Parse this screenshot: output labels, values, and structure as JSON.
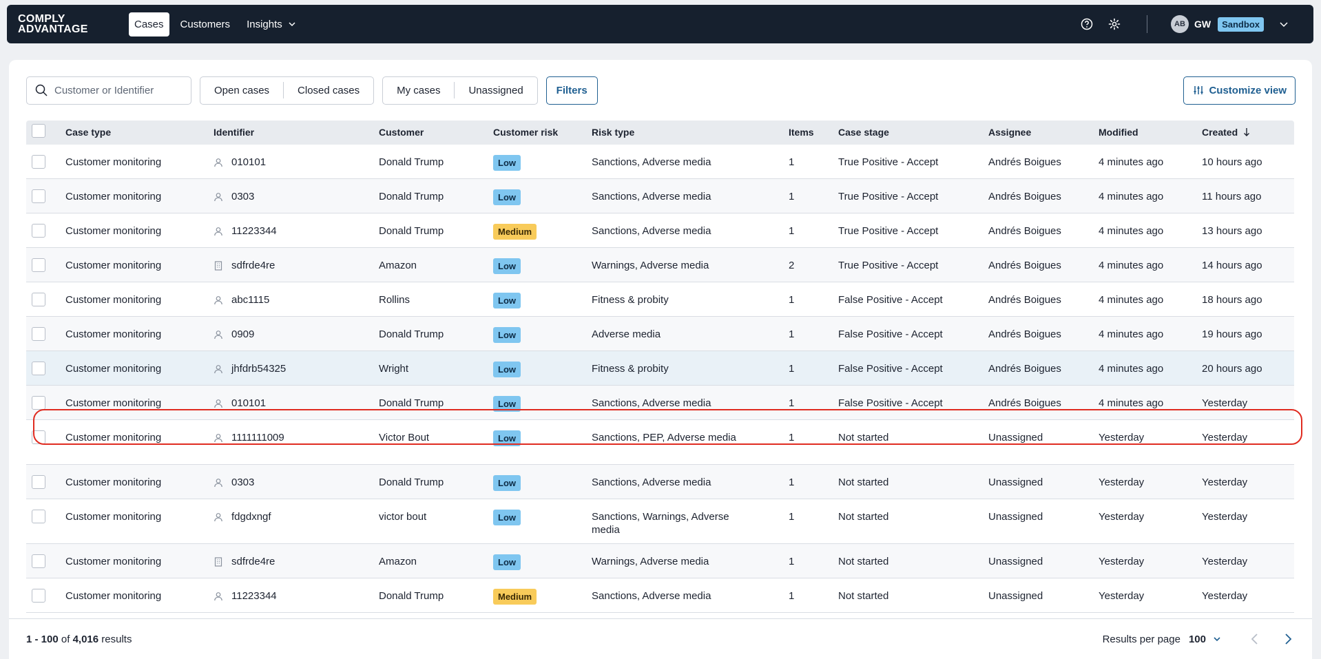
{
  "brand": {
    "line1": "COMPLY",
    "line2": "ADVANTAGE"
  },
  "nav": {
    "cases": "Cases",
    "customers": "Customers",
    "insights": "Insights"
  },
  "user": {
    "avatar_initials": "AB",
    "org_initials": "GW",
    "environment": "Sandbox"
  },
  "toolbar": {
    "search_placeholder": "Customer or Identifier",
    "open_cases": "Open cases",
    "closed_cases": "Closed cases",
    "my_cases": "My cases",
    "unassigned": "Unassigned",
    "filters": "Filters",
    "customize_view": "Customize view"
  },
  "columns": {
    "case_type": "Case type",
    "identifier": "Identifier",
    "customer": "Customer",
    "customer_risk": "Customer risk",
    "risk_type": "Risk type",
    "items": "Items",
    "case_stage": "Case stage",
    "assignee": "Assignee",
    "modified": "Modified",
    "created": "Created"
  },
  "rows": [
    {
      "case_type": "Customer monitoring",
      "id_icon": "person-icon",
      "identifier": "010101",
      "customer": "Donald Trump",
      "risk": "Low",
      "risk_type": "Sanctions, Adverse media",
      "items": "1",
      "stage": "True Positive - Accept",
      "assignee": "Andrés Boigues",
      "modified": "4 minutes ago",
      "created": "10 hours ago"
    },
    {
      "case_type": "Customer monitoring",
      "id_icon": "person-icon",
      "identifier": "0303",
      "customer": "Donald Trump",
      "risk": "Low",
      "risk_type": "Sanctions, Adverse media",
      "items": "1",
      "stage": "True Positive - Accept",
      "assignee": "Andrés Boigues",
      "modified": "4 minutes ago",
      "created": "11 hours ago"
    },
    {
      "case_type": "Customer monitoring",
      "id_icon": "person-icon",
      "identifier": "11223344",
      "customer": "Donald Trump",
      "risk": "Medium",
      "risk_type": "Sanctions, Adverse media",
      "items": "1",
      "stage": "True Positive - Accept",
      "assignee": "Andrés Boigues",
      "modified": "4 minutes ago",
      "created": "13 hours ago"
    },
    {
      "case_type": "Customer monitoring",
      "id_icon": "building-icon",
      "identifier": "sdfrde4re",
      "customer": "Amazon",
      "risk": "Low",
      "risk_type": "Warnings, Adverse media",
      "items": "2",
      "stage": "True Positive - Accept",
      "assignee": "Andrés Boigues",
      "modified": "4 minutes ago",
      "created": "14 hours ago"
    },
    {
      "case_type": "Customer monitoring",
      "id_icon": "person-icon",
      "identifier": "abc1115",
      "customer": "Rollins",
      "risk": "Low",
      "risk_type": "Fitness & probity",
      "items": "1",
      "stage": "False Positive - Accept",
      "assignee": "Andrés Boigues",
      "modified": "4 minutes ago",
      "created": "18 hours ago"
    },
    {
      "case_type": "Customer monitoring",
      "id_icon": "person-icon",
      "identifier": "0909",
      "customer": "Donald Trump",
      "risk": "Low",
      "risk_type": "Adverse media",
      "items": "1",
      "stage": "False Positive - Accept",
      "assignee": "Andrés Boigues",
      "modified": "4 minutes ago",
      "created": "19 hours ago"
    },
    {
      "case_type": "Customer monitoring",
      "id_icon": "person-icon",
      "identifier": "jhfdrb54325",
      "customer": "Wright",
      "risk": "Low",
      "risk_type": "Fitness & probity",
      "items": "1",
      "stage": "False Positive - Accept",
      "assignee": "Andrés Boigues",
      "modified": "4 minutes ago",
      "created": "20 hours ago"
    },
    {
      "case_type": "Customer monitoring",
      "id_icon": "person-icon",
      "identifier": "010101",
      "customer": "Donald Trump",
      "risk": "Low",
      "risk_type": "Sanctions, Adverse media",
      "items": "1",
      "stage": "False Positive - Accept",
      "assignee": "Andrés Boigues",
      "modified": "4 minutes ago",
      "created": "Yesterday"
    },
    {
      "case_type": "Customer monitoring",
      "id_icon": "person-icon",
      "identifier": "1111111009",
      "customer": "Victor Bout",
      "risk": "Low",
      "risk_type": "Sanctions, PEP, Adverse media",
      "items": "1",
      "stage": "Not started",
      "assignee": "Unassigned",
      "modified": "Yesterday",
      "created": "Yesterday"
    },
    {
      "case_type": "Customer monitoring",
      "id_icon": "person-icon",
      "identifier": "0303",
      "customer": "Donald Trump",
      "risk": "Low",
      "risk_type": "Sanctions, Adverse media",
      "items": "1",
      "stage": "Not started",
      "assignee": "Unassigned",
      "modified": "Yesterday",
      "created": "Yesterday"
    },
    {
      "case_type": "Customer monitoring",
      "id_icon": "person-icon",
      "identifier": "fdgdxngf",
      "customer": "victor bout",
      "risk": "Low",
      "risk_type": "Sanctions, Warnings, Adverse media",
      "items": "1",
      "stage": "Not started",
      "assignee": "Unassigned",
      "modified": "Yesterday",
      "created": "Yesterday"
    },
    {
      "case_type": "Customer monitoring",
      "id_icon": "building-icon",
      "identifier": "sdfrde4re",
      "customer": "Amazon",
      "risk": "Low",
      "risk_type": "Warnings, Adverse media",
      "items": "1",
      "stage": "Not started",
      "assignee": "Unassigned",
      "modified": "Yesterday",
      "created": "Yesterday"
    },
    {
      "case_type": "Customer monitoring",
      "id_icon": "person-icon",
      "identifier": "11223344",
      "customer": "Donald Trump",
      "risk": "Medium",
      "risk_type": "Sanctions, Adverse media",
      "items": "1",
      "stage": "Not started",
      "assignee": "Unassigned",
      "modified": "Yesterday",
      "created": "Yesterday"
    }
  ],
  "footer": {
    "range": "1 - 100",
    "of": "of",
    "total": "4,016",
    "results": "results",
    "results_per_page_label": "Results per page",
    "results_per_page": "100"
  },
  "colors": {
    "nav_bg": "#16202e",
    "accent": "#1f5f91",
    "low_badge": "#7fc6f0",
    "medium_badge": "#f8cb5a",
    "highlight": "#e02b20"
  }
}
